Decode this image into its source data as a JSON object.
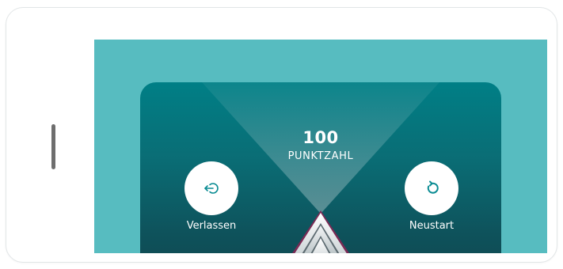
{
  "score": {
    "value": "100",
    "label": "PUNKTZAHL"
  },
  "actions": {
    "leave": {
      "label": "Verlassen",
      "icon": "exit-icon"
    },
    "restart": {
      "label": "Neustart",
      "icon": "restart-icon"
    }
  },
  "colors": {
    "background": "#57bcc0",
    "panel_top": "#007f86",
    "panel_bottom": "#104952",
    "accent": "#0a8c93",
    "button": "#ffffff"
  }
}
